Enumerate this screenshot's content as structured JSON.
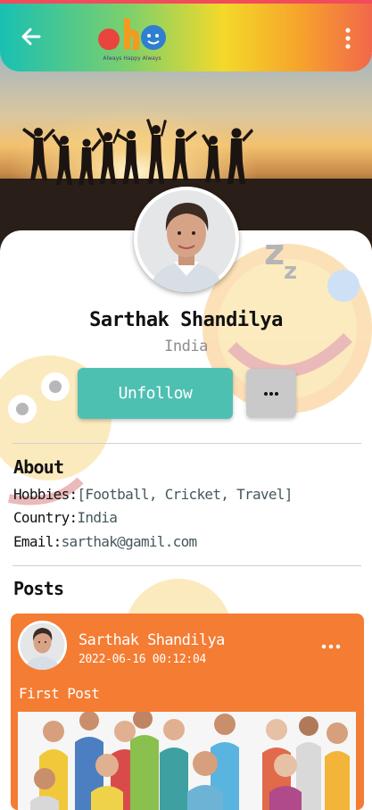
{
  "header": {
    "logo_text": "ah6",
    "logo_tagline": "Always Happy Always"
  },
  "profile": {
    "name": "Sarthak Shandilya",
    "country": "India",
    "unfollow_label": "Unfollow",
    "more_label": "···"
  },
  "about": {
    "heading": "About",
    "hobbies_label": "Hobbies:",
    "hobbies_value": "[Football, Cricket, Travel]",
    "country_label": "Country:",
    "country_value": "India",
    "email_label": "Email:",
    "email_value": "sarthak@gamil.com"
  },
  "posts": {
    "heading": "Posts",
    "items": [
      {
        "author": "Sarthak Shandilya",
        "timestamp": "2022-06-16 00:12:04",
        "title": "First Post"
      }
    ]
  },
  "colors": {
    "accent": "#4ec0b2",
    "post_card": "#f47c33",
    "top_bar_red": "#f14b5c"
  },
  "icons": [
    "back-arrow-icon",
    "app-logo",
    "overflow-menu-icon",
    "more-dots-icon"
  ]
}
